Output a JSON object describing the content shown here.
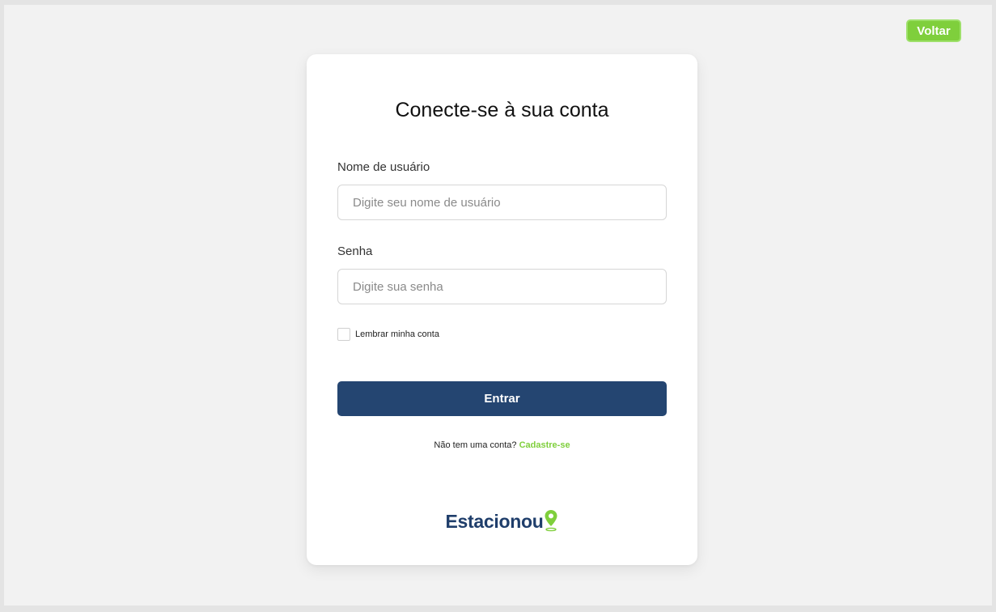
{
  "header": {
    "back_label": "Voltar"
  },
  "login": {
    "title": "Conecte-se à sua conta",
    "username_label": "Nome de usuário",
    "username_placeholder": "Digite seu nome de usuário",
    "username_value": "",
    "password_label": "Senha",
    "password_placeholder": "Digite sua senha",
    "password_value": "",
    "remember_label": "Lembrar minha conta",
    "remember_checked": false,
    "submit_label": "Entrar",
    "signup_prompt": "Não tem uma conta?",
    "signup_link": "Cadastre-se"
  },
  "brand": {
    "name": "Estacionou",
    "icon": "map-pin-icon"
  },
  "colors": {
    "accent_green": "#7fcf3c",
    "primary_navy": "#244571",
    "brand_navy": "#1f3e6b",
    "background": "#f2f2f2"
  }
}
